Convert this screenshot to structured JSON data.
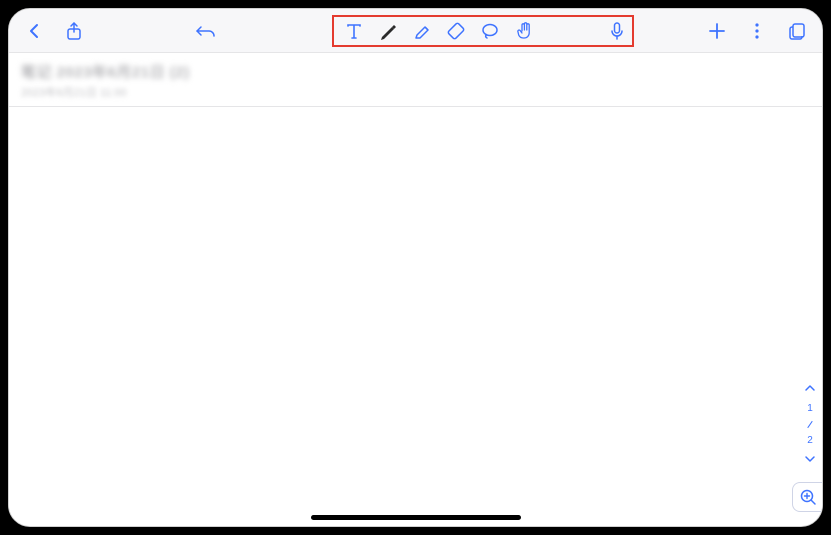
{
  "toolbar": {
    "back_label": "Back",
    "share_label": "Share",
    "undo_label": "Undo",
    "tools": {
      "text": "Text",
      "pen": "Pen",
      "highlighter": "Highlighter",
      "eraser": "Eraser",
      "lasso": "Lasso",
      "gesture": "Gesture"
    },
    "mic_label": "Microphone",
    "add_label": "Add",
    "more_label": "More",
    "pages_label": "Pages"
  },
  "document": {
    "title": "笔记 2023年6月21日 (2)",
    "subtitle": "2023年6月21日 11:00"
  },
  "pager": {
    "current": "1",
    "total": "2"
  },
  "colors": {
    "accent": "#3e73ff",
    "highlight_border": "#e43b2f"
  }
}
